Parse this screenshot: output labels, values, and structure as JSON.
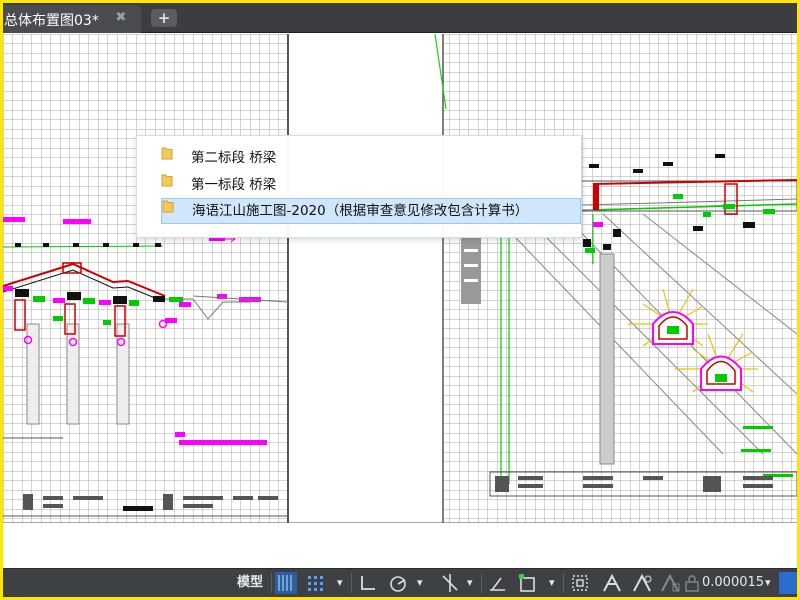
{
  "tab": {
    "title": "总体布置图03*",
    "close_glyph": "✖",
    "new_tab_glyph": "+"
  },
  "popup": {
    "items": [
      {
        "label": "第二标段 桥梁"
      },
      {
        "label": "第一标段 桥梁"
      },
      {
        "label": "海语江山施工图-2020（根据审查意见修改包含计算书）"
      }
    ]
  },
  "status": {
    "model_label": "模型",
    "scale_value": "0.000015",
    "dropdown_glyph": "▾"
  },
  "colors": {
    "frame": "#ffe600",
    "tabbar": "#3b3d42",
    "statusbar": "#3e4045",
    "selection": "#cfe6fb",
    "grid": "#a9a9a9",
    "magenta": "#ff00ff",
    "green": "#00c800",
    "accent_blue": "#2e8bff"
  }
}
